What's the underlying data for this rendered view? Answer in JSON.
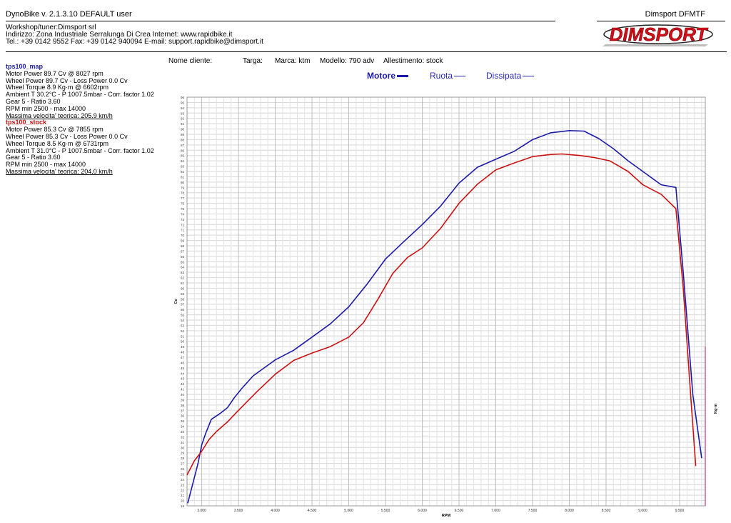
{
  "header": {
    "app_title": "DynoBike v. 2.1.3.10   DEFAULT user",
    "company": "Dimsport DFMTF",
    "workshop": "Workshop/tuner:Dimsport srl",
    "address": "Indirizzo: Zona Industriale Serralunga Di Crea Internet: www.rapidbike.it",
    "contacts": "Tel.: +39 0142 9552 Fax: +39 0142 940094 E-mail: support.rapidbike@dimsport.it",
    "logo_text": "DIMSPORT"
  },
  "client": {
    "nome_cliente": "Nome cliente:",
    "targa": "Targa:",
    "marca": "Marca: ktm",
    "modello": "Modello: 790 adv",
    "allestimento": "Allestimento: stock"
  },
  "legend": {
    "motore": "Motore",
    "ruota": "Ruota",
    "dissipata": "Dissipata"
  },
  "runs": [
    {
      "name": "tps100_map",
      "color": "#1a1aaa",
      "lines": [
        "Motor Power 89.7 Cv  @ 8027 rpm",
        "Wheel Power 89.7 Cv - Loss Power 0.0 Cv",
        "Wheel Torque 8.9 Kg·m  @ 6602rpm",
        "Ambient T 30.2°C - P 1007.5mbar - Corr. factor 1.02",
        "Gear 5 - Ratio 3.60",
        "RPM min 2500 - max 14000"
      ],
      "speed": "Massima velocita' teorica: 205.9 km/h"
    },
    {
      "name": "tps100_stock",
      "color": "#cc1111",
      "lines": [
        "Motor Power 85.3 Cv  @ 7855 rpm",
        "Wheel Power 85.3 Cv - Loss Power 0.0 Cv",
        "Wheel Torque 8.5 Kg·m  @ 6731rpm",
        "Ambient T 31.0°C - P 1007.5mbar - Corr. factor 1.02",
        "Gear 5 - Ratio 3.60",
        "RPM min 2500 - max 14000"
      ],
      "speed": "Massima velocita' teorica: 204.0 km/h"
    }
  ],
  "chart_data": {
    "type": "line",
    "xlabel": "RPM",
    "ylabel": "Cv",
    "y2label": "Kg·m",
    "xlim": [
      2800,
      9850
    ],
    "ylim": [
      19,
      96
    ],
    "x_ticks": [
      3000,
      3500,
      4000,
      4500,
      5000,
      5500,
      6000,
      6500,
      7000,
      7500,
      8000,
      8500,
      9000,
      9500
    ],
    "x_tick_labels": [
      "3.000",
      "3.500",
      "4.000",
      "4.500",
      "5.000",
      "5.500",
      "6.000",
      "6.500",
      "7.000",
      "7.500",
      "8.000",
      "8.500",
      "9.000",
      "9.500"
    ],
    "y_ticks": [
      19,
      20,
      21,
      22,
      23,
      24,
      25,
      26,
      27,
      28,
      29,
      30,
      31,
      32,
      33,
      34,
      35,
      36,
      37,
      38,
      39,
      40,
      41,
      42,
      43,
      44,
      45,
      46,
      47,
      48,
      49,
      50,
      51,
      52,
      53,
      54,
      55,
      56,
      57,
      58,
      59,
      60,
      61,
      62,
      63,
      64,
      65,
      66,
      67,
      68,
      69,
      70,
      71,
      72,
      73,
      74,
      75,
      76,
      77,
      78,
      79,
      80,
      81,
      82,
      83,
      84,
      85,
      86,
      87,
      88,
      89,
      90,
      91,
      92,
      93,
      94,
      95,
      96
    ],
    "grid": true,
    "series": [
      {
        "name": "tps100_map",
        "color": "#1a1aaa",
        "points": [
          [
            2810,
            19.5
          ],
          [
            2950,
            27
          ],
          [
            3000,
            30.5
          ],
          [
            3050,
            32.5
          ],
          [
            3130,
            35.3
          ],
          [
            3250,
            36.4
          ],
          [
            3350,
            37.5
          ],
          [
            3450,
            39.5
          ],
          [
            3550,
            41.2
          ],
          [
            3700,
            43.5
          ],
          [
            3850,
            45
          ],
          [
            4000,
            46.5
          ],
          [
            4250,
            48.3
          ],
          [
            4500,
            50.8
          ],
          [
            4750,
            53.3
          ],
          [
            5000,
            56.5
          ],
          [
            5250,
            60.8
          ],
          [
            5500,
            65.5
          ],
          [
            5750,
            68.8
          ],
          [
            6000,
            72
          ],
          [
            6250,
            75.5
          ],
          [
            6500,
            79.8
          ],
          [
            6750,
            82.8
          ],
          [
            7000,
            84.3
          ],
          [
            7250,
            85.8
          ],
          [
            7500,
            88
          ],
          [
            7750,
            89.3
          ],
          [
            8000,
            89.7
          ],
          [
            8200,
            89.6
          ],
          [
            8400,
            88.2
          ],
          [
            8600,
            86.3
          ],
          [
            8800,
            84
          ],
          [
            9000,
            82
          ],
          [
            9250,
            79.5
          ],
          [
            9450,
            79
          ],
          [
            9550,
            63
          ],
          [
            9680,
            40
          ],
          [
            9800,
            28
          ]
        ]
      },
      {
        "name": "tps100_stock",
        "color": "#cc1111",
        "points": [
          [
            2800,
            24.8
          ],
          [
            2900,
            27.5
          ],
          [
            3000,
            29.3
          ],
          [
            3100,
            31.5
          ],
          [
            3200,
            33
          ],
          [
            3350,
            34.8
          ],
          [
            3500,
            37
          ],
          [
            3750,
            40.5
          ],
          [
            4000,
            43.8
          ],
          [
            4250,
            46.4
          ],
          [
            4500,
            47.8
          ],
          [
            4750,
            49
          ],
          [
            5000,
            50.8
          ],
          [
            5200,
            53.5
          ],
          [
            5400,
            58
          ],
          [
            5600,
            62.8
          ],
          [
            5800,
            65.8
          ],
          [
            6000,
            67.6
          ],
          [
            6250,
            71.3
          ],
          [
            6500,
            76
          ],
          [
            6750,
            79.6
          ],
          [
            7000,
            82.3
          ],
          [
            7250,
            83.6
          ],
          [
            7500,
            84.8
          ],
          [
            7750,
            85.2
          ],
          [
            7900,
            85.3
          ],
          [
            8150,
            85
          ],
          [
            8350,
            84.6
          ],
          [
            8550,
            84
          ],
          [
            8800,
            82
          ],
          [
            9000,
            79.5
          ],
          [
            9250,
            77.7
          ],
          [
            9450,
            75
          ],
          [
            9550,
            60
          ],
          [
            9650,
            40
          ],
          [
            9720,
            26.5
          ]
        ]
      }
    ]
  }
}
